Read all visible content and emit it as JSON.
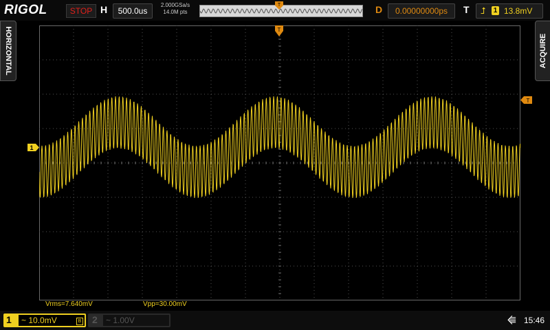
{
  "top_bar": {
    "brand": "RIGOL",
    "run_state": "STOP",
    "horizontal_label": "H",
    "timebase": "500.0us",
    "sample_rate": "2.000GSa/s",
    "memory_depth": "14.0M pts",
    "trigger_marker": "T",
    "delay_label": "D",
    "delay_value": "0.00000000ps",
    "trigger_label": "T",
    "trigger_edge_icon": "rising-edge-icon",
    "trigger_source": "1",
    "trigger_level": "13.8mV"
  },
  "side_tabs": {
    "left": "HORIZONTAL",
    "right": "ACQUIRE"
  },
  "screen": {
    "channel_marker": "1",
    "trigger_level_marker": "T",
    "trigger_position_marker": "T",
    "trace_color": "#f0d020"
  },
  "measurements": {
    "vrms": "Vrms=7.640mV",
    "vpp": "Vpp=30.00mV"
  },
  "bottom_bar": {
    "ch1_number": "1",
    "ch1_coupling": "~",
    "ch1_scale": "10.0mV",
    "ch2_number": "2",
    "ch2_coupling": "~",
    "ch2_scale": "1.00V",
    "usb_icon": "usb-icon",
    "time": "15:46"
  }
}
